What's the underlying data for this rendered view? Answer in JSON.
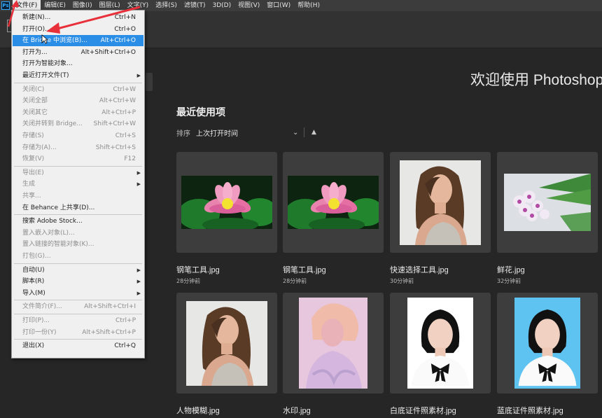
{
  "app": {
    "logo_text": "Ps"
  },
  "menubar": [
    "文件(F)",
    "编辑(E)",
    "图像(I)",
    "图层(L)",
    "文字(Y)",
    "选择(S)",
    "滤镜(T)",
    "3D(D)",
    "视图(V)",
    "窗口(W)",
    "帮助(H)"
  ],
  "file_menu": {
    "items": [
      {
        "label": "新建(N)...",
        "shortcut": "Ctrl+N",
        "enabled": true
      },
      {
        "label": "打开(O)...",
        "shortcut": "Ctrl+O",
        "enabled": true
      },
      {
        "label": "在 Bridge 中浏览(B)...",
        "shortcut": "Alt+Ctrl+O",
        "enabled": true,
        "highlighted": true
      },
      {
        "label": "打开为...",
        "shortcut": "Alt+Shift+Ctrl+O",
        "enabled": true
      },
      {
        "label": "打开为智能对象...",
        "shortcut": "",
        "enabled": true
      },
      {
        "label": "最近打开文件(T)",
        "shortcut": "",
        "enabled": true,
        "submenu": true
      },
      {
        "label": "关闭(C)",
        "shortcut": "Ctrl+W",
        "enabled": false,
        "sep_before": true
      },
      {
        "label": "关闭全部",
        "shortcut": "Alt+Ctrl+W",
        "enabled": false
      },
      {
        "label": "关闭其它",
        "shortcut": "Alt+Ctrl+P",
        "enabled": false
      },
      {
        "label": "关闭并转到 Bridge...",
        "shortcut": "Shift+Ctrl+W",
        "enabled": false
      },
      {
        "label": "存储(S)",
        "shortcut": "Ctrl+S",
        "enabled": false
      },
      {
        "label": "存储为(A)...",
        "shortcut": "Shift+Ctrl+S",
        "enabled": false
      },
      {
        "label": "恢复(V)",
        "shortcut": "F12",
        "enabled": false
      },
      {
        "label": "导出(E)",
        "shortcut": "",
        "enabled": false,
        "submenu": true,
        "sep_before": true
      },
      {
        "label": "生成",
        "shortcut": "",
        "enabled": false,
        "submenu": true
      },
      {
        "label": "共享...",
        "shortcut": "",
        "enabled": false
      },
      {
        "label": "在 Behance 上共享(D)...",
        "shortcut": "",
        "enabled": true
      },
      {
        "label": "搜索 Adobe Stock...",
        "shortcut": "",
        "enabled": true,
        "sep_before": true
      },
      {
        "label": "置入嵌入对象(L)...",
        "shortcut": "",
        "enabled": false
      },
      {
        "label": "置入链接的智能对象(K)...",
        "shortcut": "",
        "enabled": false
      },
      {
        "label": "打包(G)...",
        "shortcut": "",
        "enabled": false
      },
      {
        "label": "自动(U)",
        "shortcut": "",
        "enabled": true,
        "submenu": true,
        "sep_before": true
      },
      {
        "label": "脚本(R)",
        "shortcut": "",
        "enabled": true,
        "submenu": true
      },
      {
        "label": "导入(M)",
        "shortcut": "",
        "enabled": true,
        "submenu": true
      },
      {
        "label": "文件简介(F)...",
        "shortcut": "Alt+Shift+Ctrl+I",
        "enabled": false,
        "sep_before": true
      },
      {
        "label": "打印(P)...",
        "shortcut": "Ctrl+P",
        "enabled": false,
        "sep_before": true
      },
      {
        "label": "打印一份(Y)",
        "shortcut": "Alt+Shift+Ctrl+P",
        "enabled": false
      },
      {
        "label": "退出(X)",
        "shortcut": "Ctrl+Q",
        "enabled": true,
        "sep_before": true
      }
    ]
  },
  "home": {
    "welcome": "欢迎使用 Photoshop",
    "recent_title": "最近使用项",
    "sort_label": "排序",
    "sort_value": "上次打开时间",
    "files": [
      {
        "name": "钢笔工具.jpg",
        "time": "28分钟前",
        "thumb": "lotus-photo"
      },
      {
        "name": "钢笔工具.jpg",
        "time": "28分钟前",
        "thumb": "lotus-photo"
      },
      {
        "name": "快速选择工具.jpg",
        "time": "30分钟前",
        "thumb": "woman-portrait"
      },
      {
        "name": "鲜花.jpg",
        "time": "32分钟前",
        "thumb": "flower-photo"
      },
      {
        "name": "人物模糊.jpg",
        "time": "",
        "thumb": "woman-portrait"
      },
      {
        "name": "水印.jpg",
        "time": "",
        "thumb": "watermark-portrait"
      },
      {
        "name": "白底证件照素材.jpg",
        "time": "",
        "thumb": "id-photo-white"
      },
      {
        "name": "蓝底证件照素材.jpg",
        "time": "",
        "thumb": "id-photo-blue"
      }
    ]
  },
  "colors": {
    "accent": "#2a8ee7",
    "annotation": "#e8303a"
  }
}
